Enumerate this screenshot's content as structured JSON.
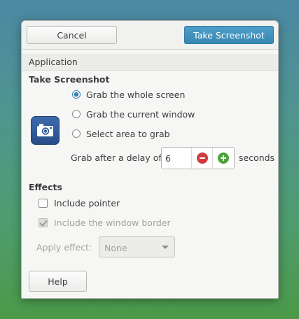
{
  "header": {
    "cancel_label": "Cancel",
    "take_label": "Take Screenshot",
    "accent_color": "#3787b3"
  },
  "section": {
    "label": "Application"
  },
  "take": {
    "heading": "Take Screenshot",
    "icon": "camera-icon",
    "options": [
      {
        "label": "Grab the whole screen",
        "checked": true
      },
      {
        "label": "Grab the current window",
        "checked": false
      },
      {
        "label": "Select area to grab",
        "checked": false
      }
    ],
    "delay_label": "Grab after a delay of",
    "delay_value": "6",
    "delay_unit": "seconds"
  },
  "effects": {
    "heading": "Effects",
    "include_pointer": {
      "label": "Include pointer",
      "checked": false
    },
    "include_border": {
      "label": "Include the window border",
      "checked": true,
      "disabled": true
    },
    "apply_label": "Apply effect:",
    "apply_value": "None"
  },
  "footer": {
    "help_label": "Help"
  }
}
